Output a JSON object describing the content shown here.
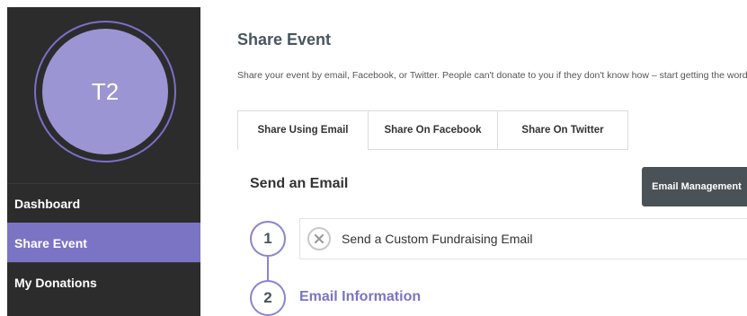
{
  "sidebar": {
    "avatar_initials": "T2",
    "items": [
      {
        "label": "Dashboard",
        "active": false
      },
      {
        "label": "Share Event",
        "active": true
      },
      {
        "label": "My Donations",
        "active": false
      }
    ]
  },
  "main": {
    "title": "Share Event",
    "intro": "Share your event by email, Facebook, or Twitter. People can't donate to you if they don't know how – start getting the word out!",
    "tabs": [
      {
        "label": "Share Using Email",
        "active": true
      },
      {
        "label": "Share On Facebook",
        "active": false
      },
      {
        "label": "Share On Twitter",
        "active": false
      }
    ],
    "section_title": "Send an Email",
    "email_management_button": "Email Management",
    "steps": [
      {
        "number": "1",
        "label": "Send a Custom Fundraising Email",
        "icon": "close-circle-icon"
      },
      {
        "number": "2",
        "label": "Email Information"
      }
    ]
  },
  "colors": {
    "sidebar_bg": "#2c2c2c",
    "accent": "#7b74c4",
    "avatar_bg": "#9c95d3",
    "button_bg": "#4a5157"
  }
}
